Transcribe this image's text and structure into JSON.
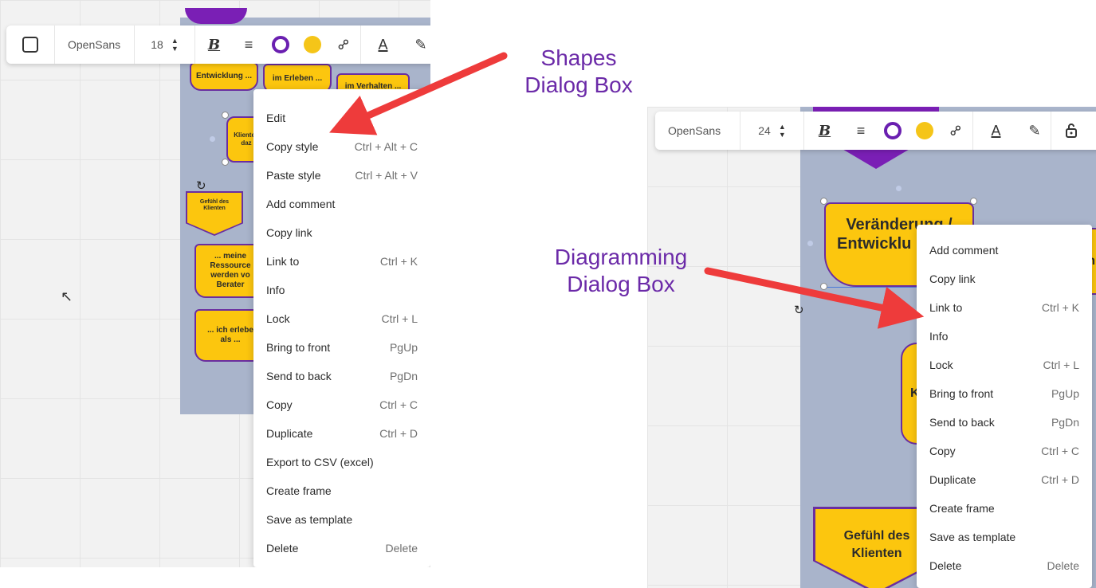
{
  "shapes_panel": {
    "toolbar": {
      "font": "OpenSans",
      "size": "18"
    },
    "board_labels": {
      "s1": "Entwicklung ...",
      "s2": "im Erleben ...",
      "s3": "im Verhalten ...",
      "s4a": "Klienten",
      "s4b": "daz",
      "s5a": "Gefühl des",
      "s5b": "Klienten",
      "s6a": "... meine",
      "s6b": "Ressource",
      "s6c": "werden vo",
      "s6d": "Berater",
      "s7a": "... ich erlebe",
      "s7b": "als ..."
    },
    "menu": [
      {
        "label": "Edit",
        "shortcut": ""
      },
      {
        "label": "Copy style",
        "shortcut": "Ctrl + Alt + C"
      },
      {
        "label": "Paste style",
        "shortcut": "Ctrl + Alt + V"
      },
      {
        "label": "Add comment",
        "shortcut": ""
      },
      {
        "label": "Copy link",
        "shortcut": ""
      },
      {
        "label": "Link to",
        "shortcut": "Ctrl + K"
      },
      {
        "label": "Info",
        "shortcut": ""
      },
      {
        "label": "Lock",
        "shortcut": "Ctrl + L"
      },
      {
        "label": "Bring to front",
        "shortcut": "PgUp"
      },
      {
        "label": "Send to back",
        "shortcut": "PgDn"
      },
      {
        "label": "Copy",
        "shortcut": "Ctrl + C"
      },
      {
        "label": "Duplicate",
        "shortcut": "Ctrl + D"
      },
      {
        "label": "Export to CSV (excel)",
        "shortcut": ""
      },
      {
        "label": "Create frame",
        "shortcut": ""
      },
      {
        "label": "Save as template",
        "shortcut": ""
      },
      {
        "label": "Delete",
        "shortcut": "Delete"
      }
    ]
  },
  "diagram_panel": {
    "toolbar": {
      "font": "OpenSans",
      "size": "24"
    },
    "board_labels": {
      "main1": "Veränderung /",
      "main2": "Entwicklu",
      "side": "K",
      "edge": "n",
      "gef1": "Gefühl des",
      "gef2": "Klienten"
    },
    "menu": [
      {
        "label": "Add comment",
        "shortcut": ""
      },
      {
        "label": "Copy link",
        "shortcut": ""
      },
      {
        "label": "Link to",
        "shortcut": "Ctrl + K"
      },
      {
        "label": "Info",
        "shortcut": ""
      },
      {
        "label": "Lock",
        "shortcut": "Ctrl + L"
      },
      {
        "label": "Bring to front",
        "shortcut": "PgUp"
      },
      {
        "label": "Send to back",
        "shortcut": "PgDn"
      },
      {
        "label": "Copy",
        "shortcut": "Ctrl + C"
      },
      {
        "label": "Duplicate",
        "shortcut": "Ctrl + D"
      },
      {
        "label": "Create frame",
        "shortcut": ""
      },
      {
        "label": "Save as template",
        "shortcut": ""
      },
      {
        "label": "Delete",
        "shortcut": "Delete"
      }
    ]
  },
  "annotations": {
    "shapes_l1": "Shapes",
    "shapes_l2": "Dialog Box",
    "diag_l1": "Diagramming",
    "diag_l2": "Dialog Box"
  },
  "colors": {
    "accent_purple": "#6a1fb0",
    "shape_yellow": "#fcc60e",
    "board_blue": "#a9b4cb",
    "arrow_red": "#ee3b3b"
  },
  "icons": {
    "select": "square-outline-icon",
    "bold": "bold-icon",
    "align": "align-center-icon",
    "border": "border-color-icon",
    "fill": "fill-color-icon",
    "link": "link-icon",
    "text_color": "text-color-icon",
    "highlight": "highlighter-icon",
    "lock": "lock-icon"
  }
}
